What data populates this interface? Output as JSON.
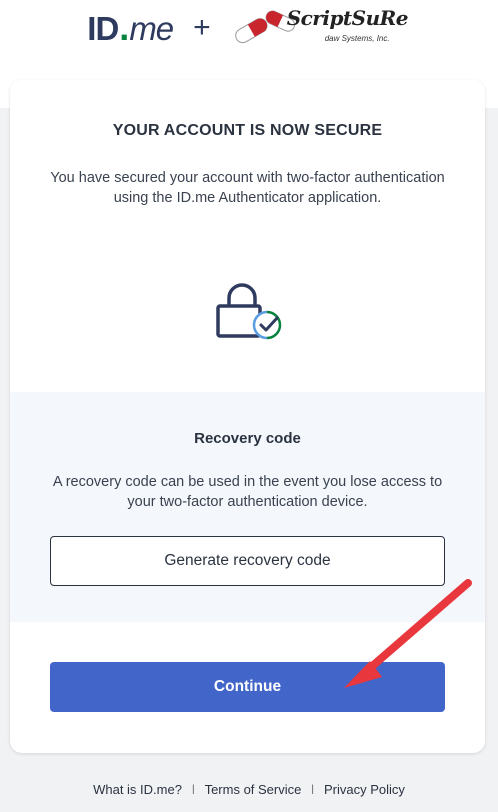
{
  "header": {
    "idme_logo": {
      "id": "ID",
      "dot": ".",
      "me": "me"
    },
    "plus": "+",
    "partner_logo": {
      "name": "ScriptSuRe",
      "sub": "daw Systems, Inc."
    }
  },
  "card": {
    "title": "YOUR ACCOUNT IS NOW SECURE",
    "description": "You have secured your account with two-factor authentication using the ID.me Authenticator application.",
    "icon": "lock-check-icon",
    "recovery": {
      "title": "Recovery code",
      "description": "A recovery code can be used in the event you lose access to your two-factor authentication device.",
      "button_label": "Generate recovery code"
    },
    "continue_label": "Continue"
  },
  "footer": {
    "links": [
      "What is ID.me?",
      "Terms of Service",
      "Privacy Policy"
    ],
    "separator": "|"
  },
  "colors": {
    "primary_button": "#4265c9",
    "idme_navy": "#2e3b5f",
    "idme_green": "#08833d",
    "annotation_arrow": "#e8383d",
    "recovery_bg": "#f4f8fc"
  }
}
